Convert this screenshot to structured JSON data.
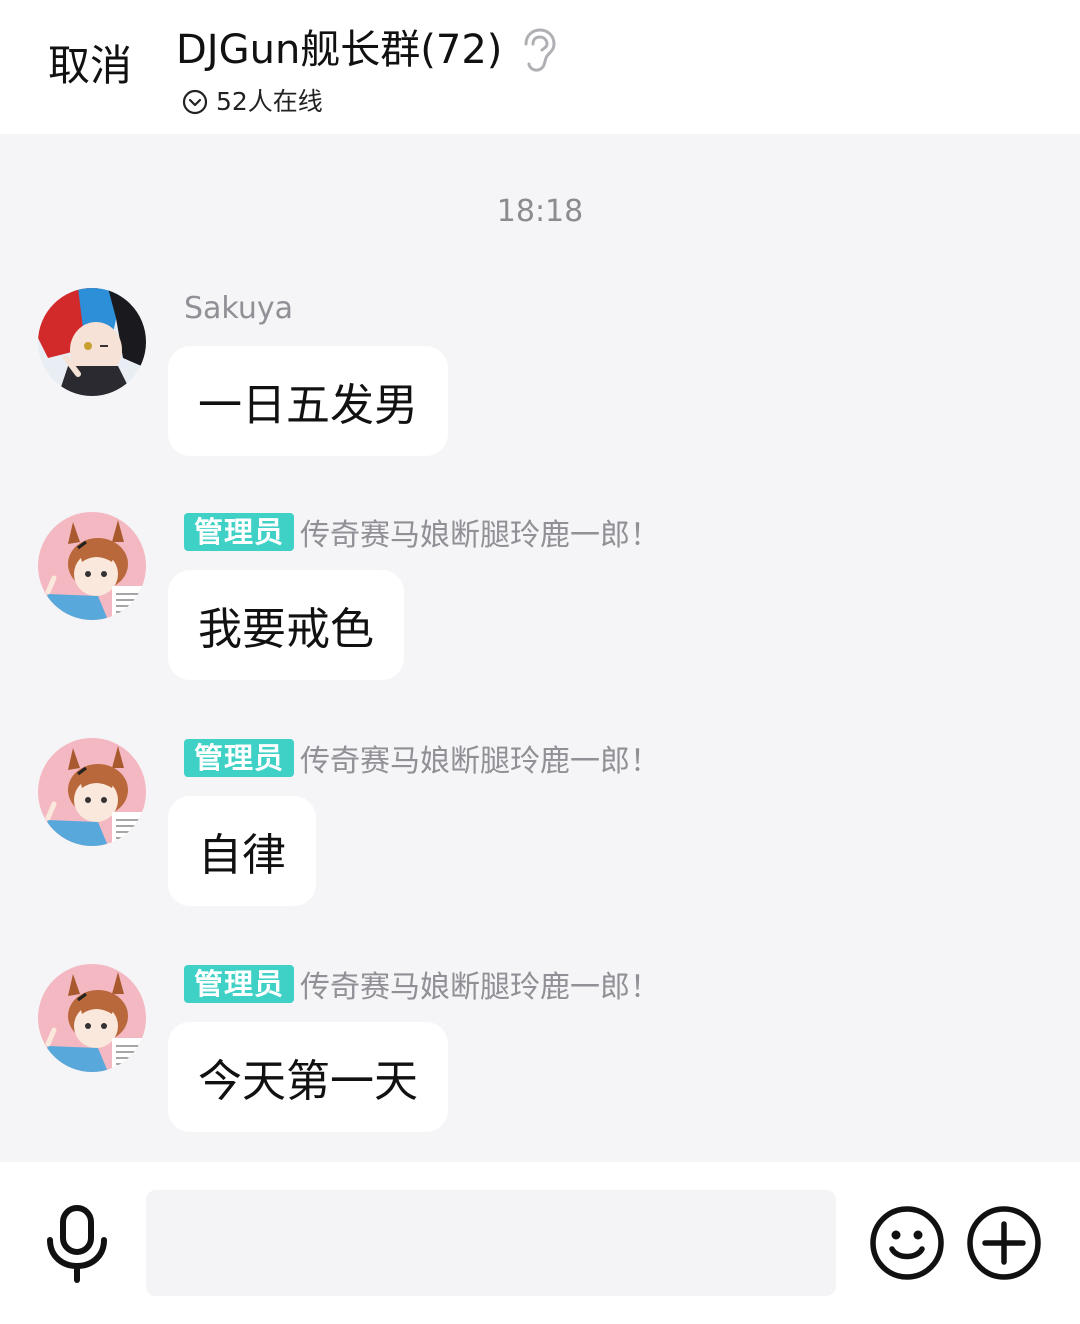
{
  "header": {
    "cancel_label": "取消",
    "title": "DJGun舰长群(72)",
    "online_text": "52人在线",
    "ear_icon": "ear-icon",
    "online_icon": "chevron-down-circle-icon"
  },
  "time_divider": "18:18",
  "messages": [
    {
      "sender": "Sakuya",
      "is_admin": false,
      "text": "一日五发男",
      "avatar": "anime-avatar-blue-red-hair"
    },
    {
      "sender": "传奇赛马娘断腿玲鹿一郎！",
      "is_admin": true,
      "badge": "管理员",
      "text": "我要戒色",
      "avatar": "anime-avatar-horse-girl"
    },
    {
      "sender": "传奇赛马娘断腿玲鹿一郎！",
      "is_admin": true,
      "badge": "管理员",
      "text": "自律",
      "avatar": "anime-avatar-horse-girl"
    },
    {
      "sender": "传奇赛马娘断腿玲鹿一郎！",
      "is_admin": true,
      "badge": "管理员",
      "text": "今天第一天",
      "avatar": "anime-avatar-horse-girl"
    }
  ],
  "input": {
    "value": "",
    "placeholder": ""
  },
  "icons": {
    "mic": "microphone-icon",
    "emoji": "smiley-icon",
    "plus": "plus-circle-icon"
  },
  "colors": {
    "admin_badge": "#3fd0c6",
    "background": "#f5f4f6",
    "bubble": "#ffffff"
  }
}
